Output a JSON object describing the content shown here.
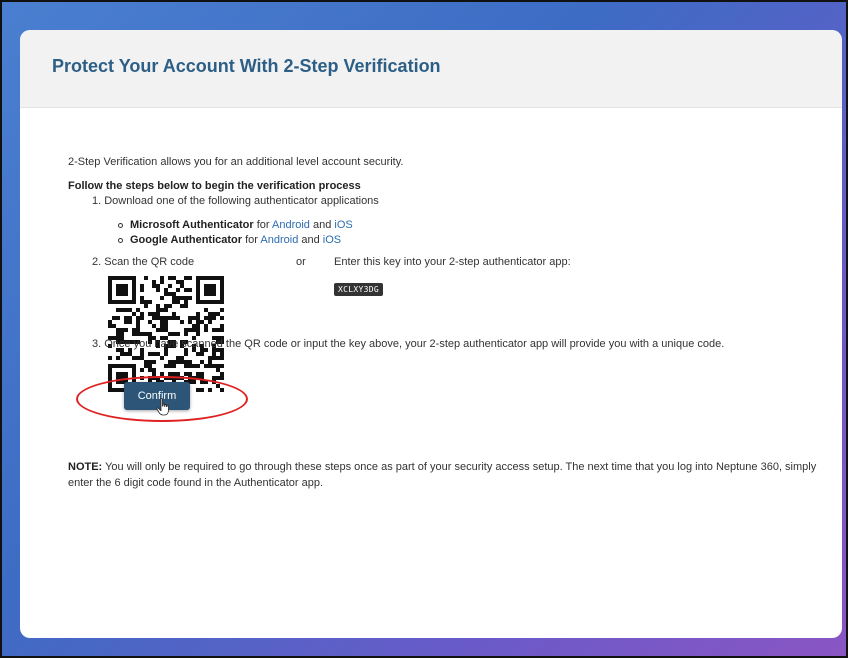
{
  "header": {
    "title": "Protect Your Account With 2-Step Verification"
  },
  "intro_text": "2-Step Verification allows you for an additional level account security.",
  "steps_title": "Follow the steps below to begin the verification process",
  "step1": "1. Download one of the following authenticator applications",
  "apps": [
    {
      "name": "Microsoft Authenticator",
      "for_text": " for ",
      "android": "Android",
      "and_text": " and ",
      "ios": "iOS"
    },
    {
      "name": "Google Authenticator",
      "for_text": " for ",
      "android": "Android",
      "and_text": " and ",
      "ios": "iOS"
    }
  ],
  "step2": {
    "scan_label": "2. Scan the QR code",
    "or_label": "or",
    "key_label": "Enter this key into your 2-step authenticator app:",
    "key_value": "XCLXY3DG"
  },
  "step3": "3. Once you have scanned the QR code or input the key above, your 2-step authenticator app will provide you with a unique code.",
  "confirm_label": "Confirm",
  "note": {
    "prefix": "NOTE:",
    "text": " You will only be required to go through these steps once as part of your security access setup. The next time that you log into Neptune 360, simply enter the 6 digit code found in the Authenticator app."
  },
  "colors": {
    "title": "#2c5e86",
    "link": "#2b6cb0",
    "button": "#2c5578",
    "highlight": "#e02020"
  }
}
